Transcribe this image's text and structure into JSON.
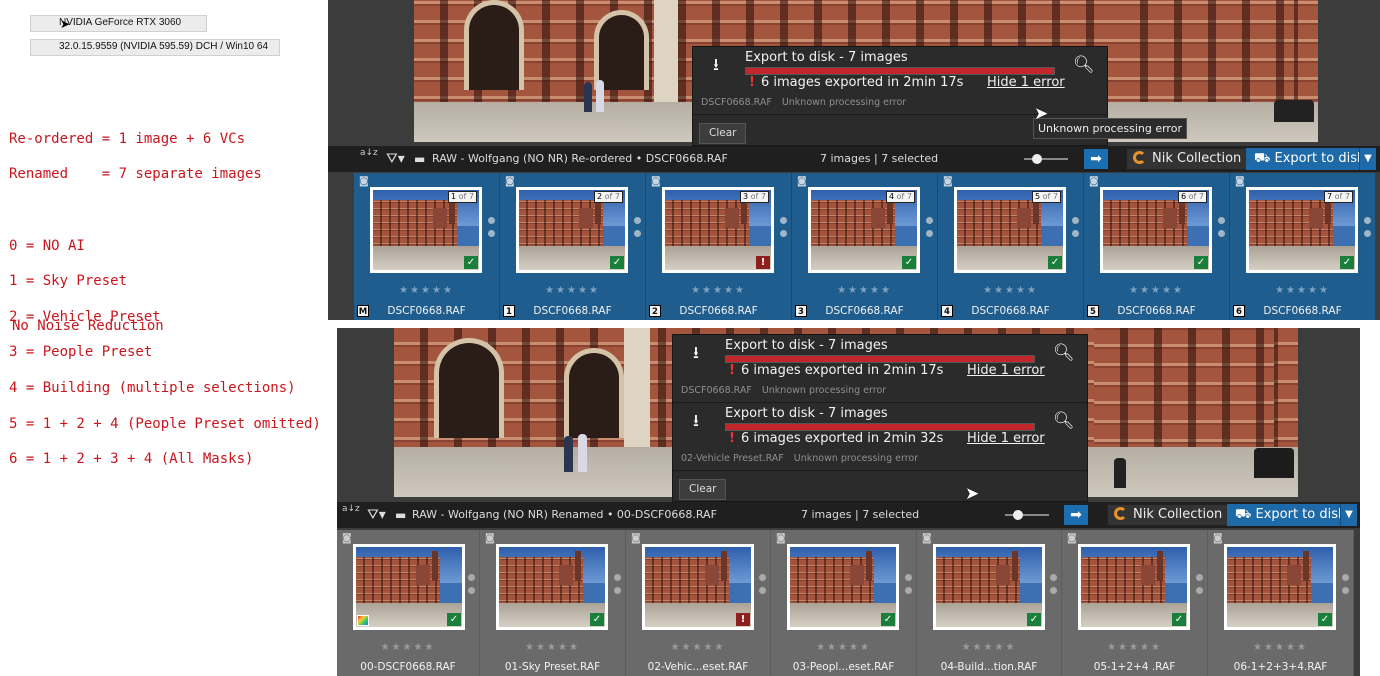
{
  "gpu": {
    "name": "NVIDIA GeForce RTX 3060",
    "driver": "32.0.15.9559 (NVIDIA 595.59) DCH / Win10 64"
  },
  "notes": {
    "lines": [
      "Re-ordered = 1 image + 6 VCs",
      "Renamed    = 7 separate images",
      "",
      "0 = NO AI",
      "1 = Sky Preset",
      "2 = Vehicle Preset",
      "3 = People Preset",
      "4 = Building (multiple selections)",
      "5 = 1 + 2 + 4 (People Preset omitted)",
      "6 = 1 + 2 + 3 + 4 (All Masks)"
    ],
    "footer": "No Noise Reduction"
  },
  "colors": {
    "accent": "#1e6aa8",
    "error": "#c0262a",
    "ok": "#1b7f3c",
    "annotation": "#c8161d"
  },
  "top": {
    "exports": [
      {
        "title": "Export to disk - 7 images",
        "status": "6 images exported in 2min 17s",
        "hide": "Hide 1 error",
        "file": "DSCF0668.RAF",
        "error": "Unknown processing error"
      }
    ],
    "clear": "Clear",
    "tooltip": "Unknown processing error",
    "toolbar": {
      "sort": "a↓z",
      "breadcrumb": "RAW - Wolfgang (NO NR) Re-ordered  •  DSCF0668.RAF",
      "count": "7 images | 7 selected",
      "nik": "Nik Collection",
      "export": "Export to disk"
    },
    "cells": [
      {
        "badge": "M",
        "vc_num": "1",
        "vc_total": "of 7",
        "name": "DSCF0668.RAF",
        "status": "ok"
      },
      {
        "badge": "1",
        "vc_num": "2",
        "vc_total": "of 7",
        "name": "DSCF0668.RAF",
        "status": "ok"
      },
      {
        "badge": "2",
        "vc_num": "3",
        "vc_total": "of 7",
        "name": "DSCF0668.RAF",
        "status": "error"
      },
      {
        "badge": "3",
        "vc_num": "4",
        "vc_total": "of 7",
        "name": "DSCF0668.RAF",
        "status": "ok"
      },
      {
        "badge": "4",
        "vc_num": "5",
        "vc_total": "of 7",
        "name": "DSCF0668.RAF",
        "status": "ok"
      },
      {
        "badge": "5",
        "vc_num": "6",
        "vc_total": "of 7",
        "name": "DSCF0668.RAF",
        "status": "ok"
      },
      {
        "badge": "6",
        "vc_num": "7",
        "vc_total": "of 7",
        "name": "DSCF0668.RAF",
        "status": "ok"
      }
    ]
  },
  "bottom": {
    "exports": [
      {
        "title": "Export to disk - 7 images",
        "status": "6 images exported in 2min 17s",
        "hide": "Hide 1 error",
        "file": "DSCF0668.RAF",
        "error": "Unknown processing error"
      },
      {
        "title": "Export to disk - 7 images",
        "status": "6 images exported in 2min 32s",
        "hide": "Hide 1 error",
        "file": "02-Vehicle Preset.RAF",
        "error": "Unknown processing error"
      }
    ],
    "clear": "Clear",
    "toolbar": {
      "sort": "a↓z",
      "breadcrumb": "RAW - Wolfgang (NO NR) Renamed  •  00-DSCF0668.RAF",
      "count": "7 images | 7 selected",
      "nik": "Nik Collection",
      "export": "Export to disk"
    },
    "cells": [
      {
        "name": "00-DSCF0668.RAF",
        "status": "ok",
        "palette": true
      },
      {
        "name": "01-Sky Preset.RAF",
        "status": "ok"
      },
      {
        "name": "02-Vehic...eset.RAF",
        "status": "error"
      },
      {
        "name": "03-Peopl...eset.RAF",
        "status": "ok"
      },
      {
        "name": "04-Build...tion.RAF",
        "status": "ok"
      },
      {
        "name": "05-1+2+4 .RAF",
        "status": "ok"
      },
      {
        "name": "06-1+2+3+4.RAF",
        "status": "ok"
      }
    ]
  },
  "icons": {
    "download": "download-icon",
    "search": "magnifier-icon",
    "filter": "filter-icon",
    "folder": "folder-icon",
    "camera": "camera-icon",
    "check": "check-icon",
    "error": "error-icon"
  }
}
